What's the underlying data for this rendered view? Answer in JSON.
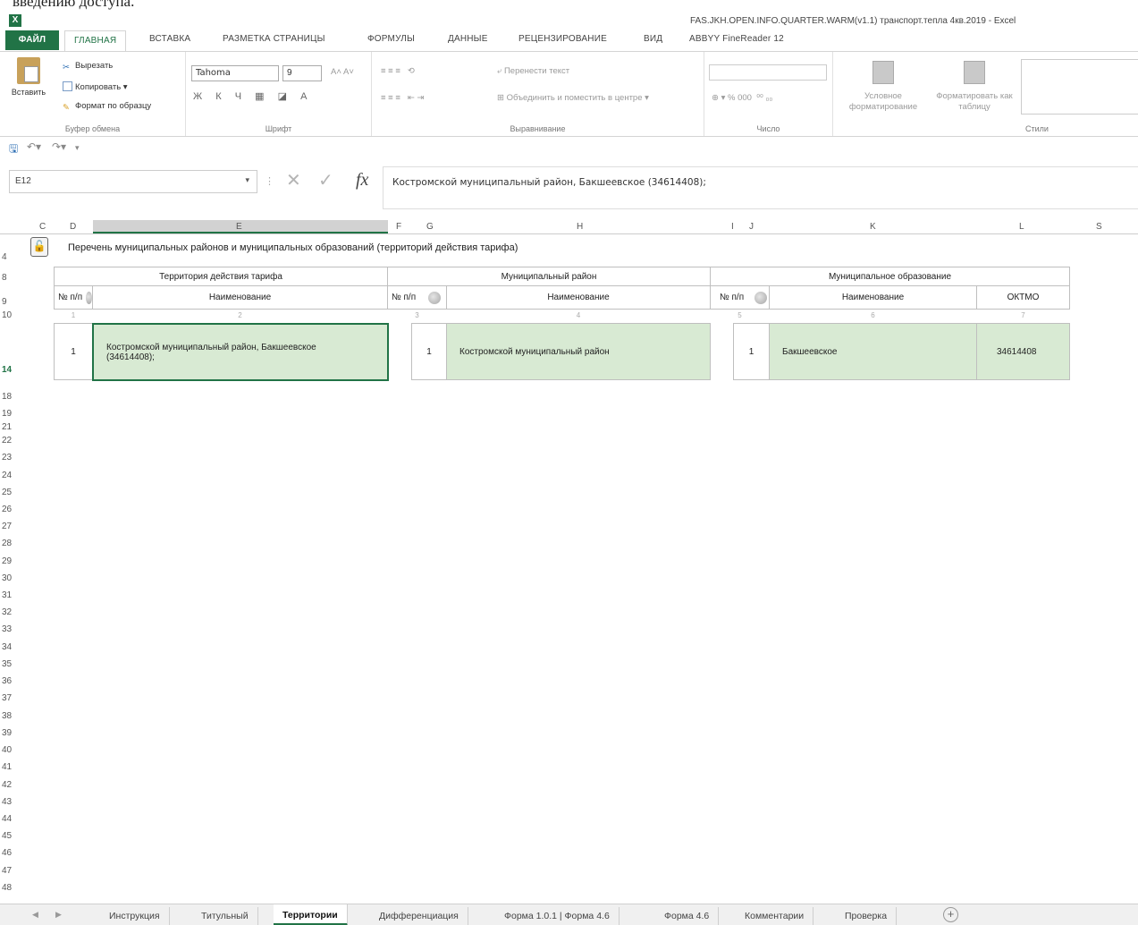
{
  "top_text": "введению доступа.",
  "window": {
    "title": "FAS.JKH.OPEN.INFO.QUARTER.WARM(v1.1) транспорт.тепла 4кв.2019 - Excel"
  },
  "ribbon": {
    "tabs": [
      "ФАЙЛ",
      "ГЛАВНАЯ",
      "ВСТАВКА",
      "РАЗМЕТКА СТРАНИЦЫ",
      "ФОРМУЛЫ",
      "ДАННЫЕ",
      "РЕЦЕНЗИРОВАНИЕ",
      "ВИД",
      "ABBYY FineReader 12"
    ],
    "clipboard": {
      "paste": "Вставить",
      "cut": "Вырезать",
      "copy": "Копировать",
      "format_painter": "Формат по образцу",
      "label": "Буфер обмена"
    },
    "font": {
      "name": "Tahoma",
      "size": "9",
      "bold": "Ж",
      "italic": "К",
      "underline": "Ч",
      "label": "Шрифт"
    },
    "alignment": {
      "wrap_text": "Перенести текст",
      "merge_center": "Объединить и поместить в центре",
      "label": "Выравнивание"
    },
    "number": {
      "format": "",
      "label": "Число"
    },
    "styles": {
      "conditional": "Условное форматирование",
      "format_table": "Форматировать как таблицу",
      "label": "Стили"
    }
  },
  "formula_bar": {
    "name_box": "E12",
    "fx": "fx",
    "content": "Костромской муниципальный район, Бакшеевское (34614408);"
  },
  "columns": [
    "C",
    "D",
    "E",
    "F",
    "G",
    "H",
    "I",
    "J",
    "K",
    "L",
    "S"
  ],
  "rows": [
    "4",
    "8",
    "9",
    "10",
    "14",
    "18",
    "19",
    "21",
    "22",
    "23",
    "24",
    "25",
    "26",
    "27",
    "28",
    "29",
    "30",
    "31",
    "32",
    "33",
    "34",
    "35",
    "36",
    "37",
    "38",
    "39",
    "40",
    "41",
    "42",
    "43",
    "44",
    "45",
    "46",
    "47",
    "48"
  ],
  "sheet": {
    "title": "Перечень муниципальных районов и муниципальных образований (территорий действия тарифа)",
    "groups": {
      "territory": "Территория действия тарифа",
      "district": "Муниципальный район",
      "municipality": "Муниципальное образование"
    },
    "headers": {
      "num": "№ п/п",
      "name": "Наименование",
      "oktmo": "ОКТМО"
    },
    "col_index": [
      "1",
      "2",
      "3",
      "4",
      "5",
      "6",
      "7"
    ],
    "row": {
      "territory_num": "1",
      "territory_name_1": "Костромской муниципальный район, Бакшеевское",
      "territory_name_2": "(34614408);",
      "district_num": "1",
      "district_name": "Костромской муниципальный район",
      "municipality_num": "1",
      "municipality_name": "Бакшеевское",
      "oktmo": "34614408"
    }
  },
  "sheet_tabs": [
    "Инструкция",
    "Титульный",
    "Территории",
    "Дифференциация",
    "Форма 1.0.1 | Форма 4.6",
    "Форма 4.6",
    "Комментарии",
    "Проверка"
  ],
  "active_sheet": "Территории",
  "colors": {
    "excel_green": "#217346",
    "fill_green": "#d8ead3"
  }
}
